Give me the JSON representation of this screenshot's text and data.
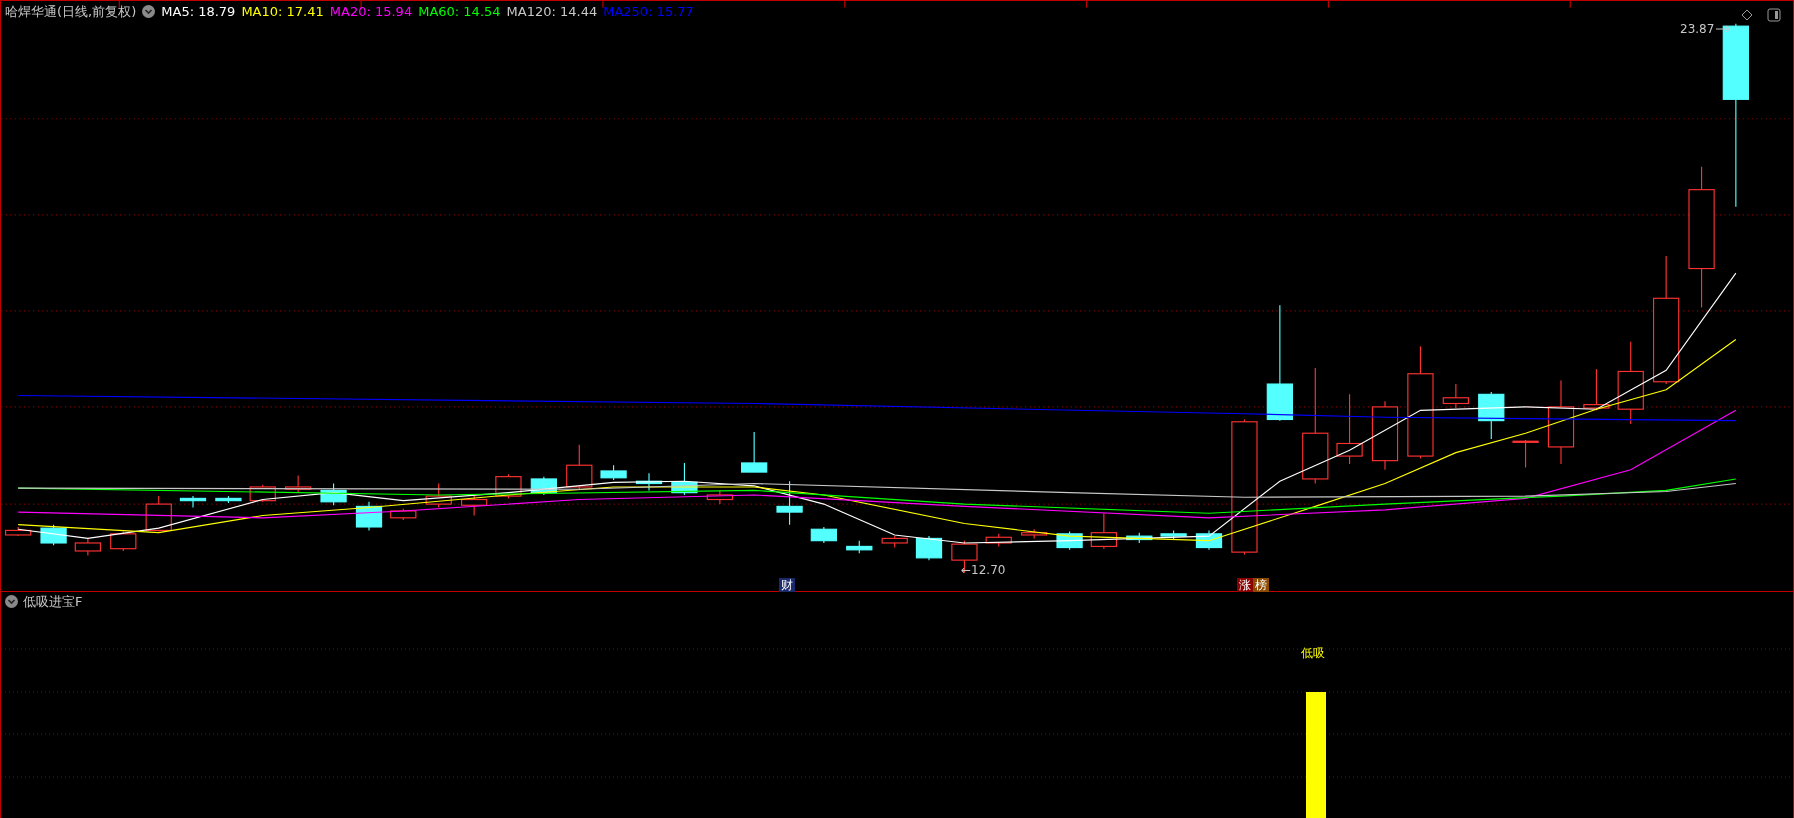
{
  "chart": {
    "title": "哈焊华通(日线,前复权)",
    "moving_averages": [
      {
        "label": "MA5: 18.79",
        "color": "#ffffff"
      },
      {
        "label": "MA10: 17.41",
        "color": "#ffff00"
      },
      {
        "label": "MA20: 15.94",
        "color": "#ff00ff"
      },
      {
        "label": "MA60: 14.54",
        "color": "#00ff00"
      },
      {
        "label": "MA120: 14.44",
        "color": "#c8c8c8"
      },
      {
        "label": "MA250: 15.77",
        "color": "#0000ff"
      }
    ],
    "high_label": "23.87",
    "low_label": "←12.70",
    "event_tags": [
      {
        "text": "财",
        "color": "#1a2a6a"
      },
      {
        "text": "涨",
        "color": "#8b0000"
      },
      {
        "text": "榜",
        "color": "#8b4a00"
      }
    ]
  },
  "indicator": {
    "title": "低吸进宝F",
    "signal_label": "低吸"
  }
}
